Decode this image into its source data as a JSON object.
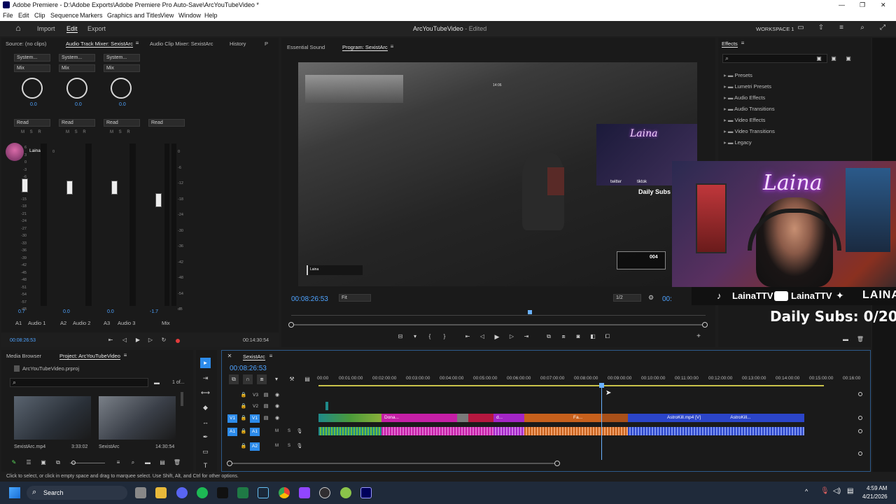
{
  "window": {
    "title": "Adobe Premiere - D:\\Adobe Exports\\Adobe Premiere Pro Auto-Save\\ArcYouTubeVideo *",
    "controls": [
      "—",
      "❐",
      "✕"
    ]
  },
  "menu": [
    "File",
    "Edit",
    "Clip",
    "Sequence",
    "Markers",
    "Graphics and Titles",
    "View",
    "Window",
    "Help"
  ],
  "header": {
    "tabs": [
      "Import",
      "Edit",
      "Export"
    ],
    "active_tab": "Edit",
    "project_title": "ArcYouTubeVideo",
    "status": "- Edited",
    "workspace": "WORKSPACE 1"
  },
  "source_panel": {
    "tabs": [
      "Source: (no clips)",
      "Audio Track Mixer: SexistArc",
      "Audio Clip Mixer: SexistArc",
      "History",
      "P"
    ],
    "channels": [
      {
        "input": "System...",
        "mode": "Mix",
        "value": "0.0",
        "automation": "Read",
        "peak": "0.7",
        "id": "A1",
        "name": "Audio 1"
      },
      {
        "input": "System...",
        "mode": "Mix",
        "value": "0.0",
        "automation": "Read",
        "peak": "0.0",
        "id": "A2",
        "name": "Audio 2"
      },
      {
        "input": "System...",
        "mode": "Mix",
        "value": "0.0",
        "automation": "Read",
        "peak": "0.0",
        "id": "A3",
        "name": "Audio 3"
      },
      {
        "input": "",
        "mode": "",
        "value": "",
        "automation": "Read",
        "peak": "-1.7",
        "id": "",
        "name": "Mix"
      }
    ],
    "msr": [
      "M",
      "S",
      "R"
    ],
    "db_scale": [
      "0",
      "-6",
      "-12",
      "-18",
      "-24",
      "-30",
      "-36",
      "-42",
      "-48",
      "-54",
      "dB"
    ],
    "left_scale": [
      "6",
      "3",
      "0",
      "-3",
      "-6",
      "-9",
      "-12",
      "-15",
      "-18",
      "-21",
      "-24",
      "-27",
      "-30",
      "-33",
      "-36",
      "-39",
      "-42",
      "-45",
      "-48",
      "-51",
      "-54",
      "-57",
      "dB"
    ],
    "timecode": "00:08:26:53",
    "duration": "00:14:30:54"
  },
  "program_panel": {
    "tabs": [
      "Essential Sound",
      "Program: SexistArc"
    ],
    "timecode": "00:08:26:53",
    "fit": "Fit",
    "resolution": "1/2",
    "timecode_right": "00:",
    "overlay": {
      "logo_text": "Laina",
      "social": [
        "LainaTTV",
        "LainaTTV",
        "LAINA"
      ],
      "daily_subs": "Daily Subs: 0/20",
      "small_social": [
        "twitter",
        "tiktok"
      ],
      "small_daily_subs": "Daily Subs",
      "hud_player": "Laina",
      "hud_ammo": "004",
      "hud_time": "14:06"
    }
  },
  "effects_panel": {
    "title": "Effects",
    "items": [
      "Presets",
      "Lumetri Presets",
      "Audio Effects",
      "Audio Transitions",
      "Video Effects",
      "Video Transitions",
      "Legacy"
    ]
  },
  "project_panel": {
    "tabs": [
      "Media Browser",
      "Project: ArcYouTubeVideo"
    ],
    "file": "ArcYouTubeVideo.prproj",
    "count": "1 of...",
    "items": [
      {
        "name": "SexistArc.mp4",
        "duration": "3:33:02"
      },
      {
        "name": "SexistArc",
        "duration": "14:30:54"
      }
    ]
  },
  "timeline": {
    "sequence": "SexistArc",
    "timecode": "00:08:26:53",
    "ruler": [
      "00:00",
      "00:01:00:00",
      "00:02:00:00",
      "00:03:00:00",
      "00:04:00:00",
      "00:05:00:00",
      "00:06:00:00",
      "00:07:00:00",
      "00:08:00:00",
      "00:09:00:00",
      "00:10:00:00",
      "00:11:00:00",
      "00:12:00:00",
      "00:13:00:00",
      "00:14:00:00",
      "00:15:00:00",
      "00:16:00"
    ],
    "tracks": [
      "V3",
      "V2",
      "V1",
      "A1",
      "A2"
    ],
    "source_patch": [
      "V1",
      "A1"
    ],
    "clip_labels": [
      "Dona...",
      "d...",
      "Fa...",
      "AstroKill.mp4 [V]",
      "AstroKill..."
    ],
    "fx": "fx",
    "track_ms": [
      "M",
      "S"
    ]
  },
  "status_bar": {
    "text": "Click to select, or click in empty space and drag to marquee select. Use Shift, Alt, and Ctrl for other options."
  },
  "taskbar": {
    "search": "Search",
    "time": "4:59 AM",
    "date": "4/21/2026"
  },
  "colors": {
    "accent": "#2d8ceb",
    "timecode_blue": "#4ea3ff",
    "clip_teal": "#1f8a8a",
    "clip_magenta": "#c51fa6",
    "clip_orange": "#c7601c",
    "clip_blue": "#2b45c9",
    "playhead": "#6ab1ff"
  }
}
